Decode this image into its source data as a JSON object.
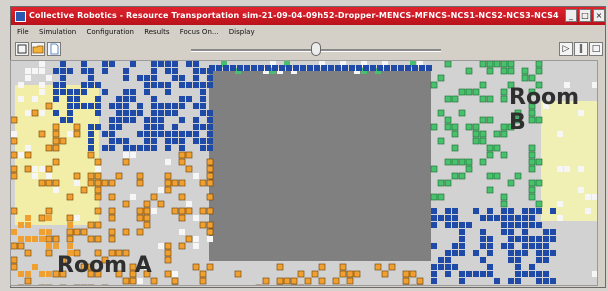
{
  "window": {
    "title": "Collective Robotics - Resource Transportation sim-21-09-04-09h52-Dropper-MENCS-MFNCS-NCS1-NCS2-NCS3-NCS4",
    "buttons": {
      "minimize": "_",
      "maximize": "□",
      "close": "×"
    }
  },
  "menu": [
    "File",
    "Simulation",
    "Configuration",
    "Results",
    "Focus On...",
    "Display"
  ],
  "toolbar": {
    "left_icons": [
      "select-tool-icon",
      "folder-icon",
      "document-icon"
    ],
    "right_icons": [
      "play-icon",
      "pause-icon",
      "stop-icon"
    ],
    "play_label": "▷",
    "pause_label": "‖",
    "stop_label": "□",
    "speed_slider_value": 0.48
  },
  "arena": {
    "room_a_label": "Room A",
    "room_b_label": "Room B",
    "colors": {
      "floor": "#d2d2d2",
      "obstacle": "#808080",
      "room_a_zone": "#f3eea7",
      "room_b_zone": "#f1f0b4",
      "blue_robot": "#1f4aa8",
      "orange_resource": "#f0a030",
      "green_robot": "#48c06c",
      "white_cell": "#f6f6f6"
    }
  }
}
